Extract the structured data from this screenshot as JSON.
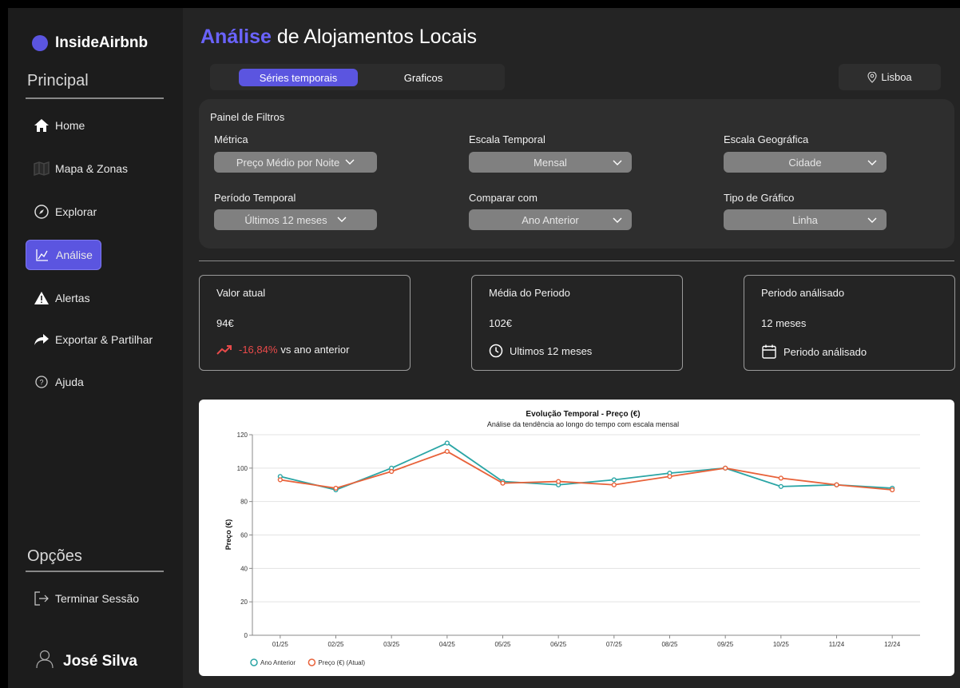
{
  "brand": {
    "name": "InsideAirbnb",
    "dot_color": "#5b55e0"
  },
  "sidebar": {
    "principal_title": "Principal",
    "items": [
      {
        "label": "Home",
        "icon": "home-icon"
      },
      {
        "label": "Mapa & Zonas",
        "icon": "map-icon"
      },
      {
        "label": "Explorar",
        "icon": "compass-icon"
      },
      {
        "label": "Análise",
        "icon": "chart-icon",
        "active": true
      },
      {
        "label": "Alertas",
        "icon": "warning-icon"
      },
      {
        "label": "Exportar & Partilhar",
        "icon": "share-icon"
      },
      {
        "label": "Ajuda",
        "icon": "help-icon"
      }
    ],
    "options_title": "Opções",
    "logout_label": "Terminar Sessão",
    "user_name": "José Silva"
  },
  "header": {
    "title_accent": "Análise",
    "title_rest": " de Alojamentos Locais",
    "accent_color": "#6a63ff"
  },
  "tabs": [
    {
      "label": "Séries temporais",
      "active": true
    },
    {
      "label": "Graficos",
      "active": false
    }
  ],
  "location": {
    "label": "Lisboa"
  },
  "filters": {
    "title": "Painel de Filtros",
    "metric": {
      "label": "Métrica",
      "value": "Preço Médio por Noite"
    },
    "time_scale": {
      "label": "Escala Temporal",
      "value": "Mensal"
    },
    "geo_scale": {
      "label": "Escala Geográfica",
      "value": "Cidade"
    },
    "period": {
      "label": "Período Temporal",
      "value": "Últimos 12 meses"
    },
    "compare": {
      "label": "Comparar com",
      "value": "Ano Anterior"
    },
    "chart_type": {
      "label": "Tipo de Gráfico",
      "value": "Linha"
    }
  },
  "cards": {
    "current": {
      "title": "Valor atual",
      "value": "94€",
      "change": "-16,84%",
      "change_suffix": " vs ano anterior"
    },
    "average": {
      "title": "Média do Periodo",
      "value": "102€",
      "foot": "Ultimos 12 meses"
    },
    "period": {
      "title": "Periodo análisado",
      "value": "12 meses",
      "foot": "Periodo análisado"
    }
  },
  "chart_data": {
    "type": "line",
    "title": "Evolução Temporal - Preço (€)",
    "subtitle": "Análise da tendência ao longo do tempo com escala mensal",
    "ylabel": "Preço (€)",
    "xlabel": "",
    "ylim": [
      0,
      120
    ],
    "yticks": [
      0,
      20,
      40,
      60,
      80,
      100,
      120
    ],
    "grid": true,
    "legend_position": "bottom-left",
    "categories": [
      "01/25",
      "02/25",
      "03/25",
      "04/25",
      "05/25",
      "06/25",
      "07/25",
      "08/25",
      "09/25",
      "10/25",
      "11/24",
      "12/24"
    ],
    "series": [
      {
        "name": "Ano Anterior",
        "color": "#2aa5a5",
        "values": [
          95,
          87,
          100,
          115,
          92,
          90,
          93,
          97,
          100,
          89,
          90,
          88
        ]
      },
      {
        "name": "Preço (€) (Atual)",
        "color": "#e8623a",
        "values": [
          93,
          88,
          98,
          110,
          91,
          92,
          90,
          95,
          100,
          94,
          90,
          87
        ]
      }
    ]
  }
}
